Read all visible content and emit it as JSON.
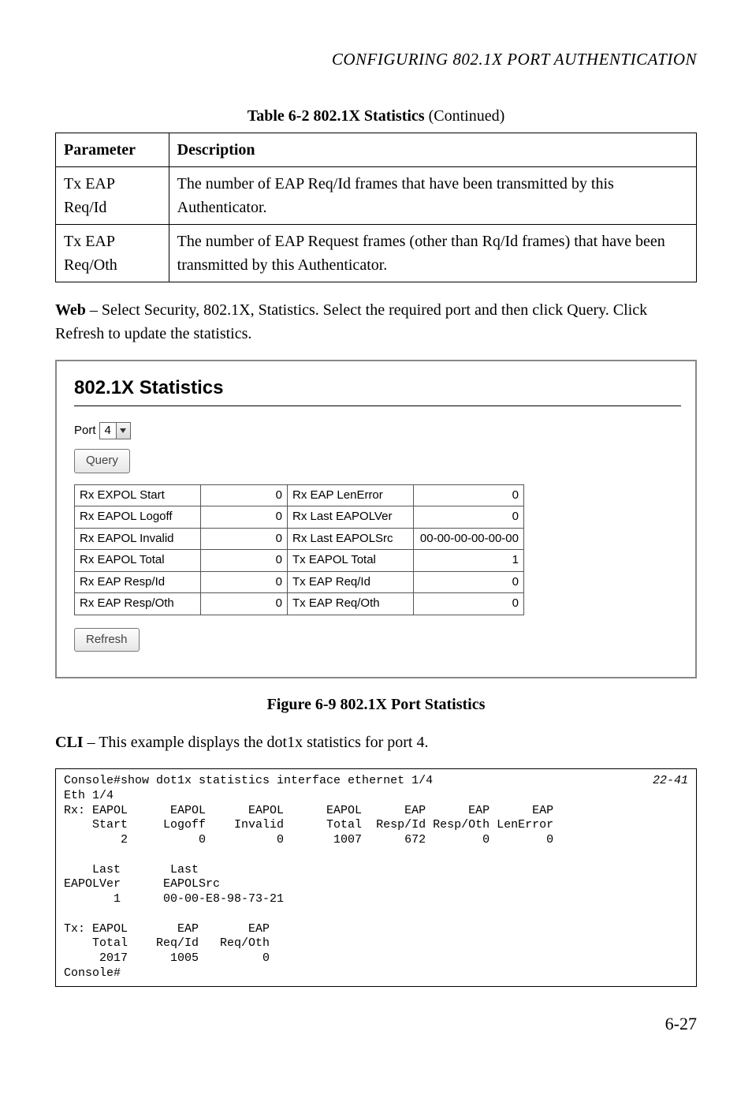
{
  "page_header": "CONFIGURING 802.1X PORT AUTHENTICATION",
  "table_caption_main": "Table 6-2  802.1X Statistics",
  "table_caption_cont": " (Continued)",
  "param_table": {
    "headers": [
      "Parameter",
      "Description"
    ],
    "rows": [
      {
        "param": "Tx EAP Req/Id",
        "desc": "The number of EAP Req/Id frames that have been transmitted by this Authenticator."
      },
      {
        "param": "Tx EAP Req/Oth",
        "desc": "The number of EAP Request frames (other than Rq/Id frames) that have been transmitted by this Authenticator."
      }
    ]
  },
  "web_text_bold": "Web",
  "web_text_rest": " – Select Security, 802.1X, Statistics. Select the required port and then click Query. Click Refresh to update the statistics.",
  "panel": {
    "title": "802.1X Statistics",
    "port_label": "Port",
    "port_value": "4",
    "query_btn": "Query",
    "refresh_btn": "Refresh",
    "stats": [
      {
        "l1": "Rx EXPOL Start",
        "v1": "0",
        "l2": "Rx EAP LenError",
        "v2": "0"
      },
      {
        "l1": "Rx EAPOL Logoff",
        "v1": "0",
        "l2": "Rx Last EAPOLVer",
        "v2": "0"
      },
      {
        "l1": "Rx EAPOL Invalid",
        "v1": "0",
        "l2": "Rx Last EAPOLSrc",
        "v2": "00-00-00-00-00-00"
      },
      {
        "l1": "Rx EAPOL Total",
        "v1": "0",
        "l2": "Tx EAPOL Total",
        "v2": "1"
      },
      {
        "l1": "Rx EAP Resp/Id",
        "v1": "0",
        "l2": "Tx EAP Req/Id",
        "v2": "0"
      },
      {
        "l1": "Rx EAP Resp/Oth",
        "v1": "0",
        "l2": "Tx EAP Req/Oth",
        "v2": "0"
      }
    ]
  },
  "figure_caption": "Figure 6-9  802.1X Port Statistics",
  "cli_text_bold": "CLI",
  "cli_text_rest": " – This example displays the dot1x statistics for port 4.",
  "cli_ref": "22-41",
  "cli_block": "Console#show dot1x statistics interface ethernet 1/4\nEth 1/4\nRx: EAPOL      EAPOL      EAPOL      EAPOL      EAP      EAP      EAP\n    Start     Logoff    Invalid      Total  Resp/Id Resp/Oth LenError\n        2          0          0       1007      672        0        0\n\n    Last       Last\nEAPOLVer      EAPOLSrc\n       1      00-00-E8-98-73-21\n\nTx: EAPOL       EAP       EAP\n    Total    Req/Id   Req/Oth\n     2017      1005         0\nConsole#",
  "page_number": "6-27"
}
